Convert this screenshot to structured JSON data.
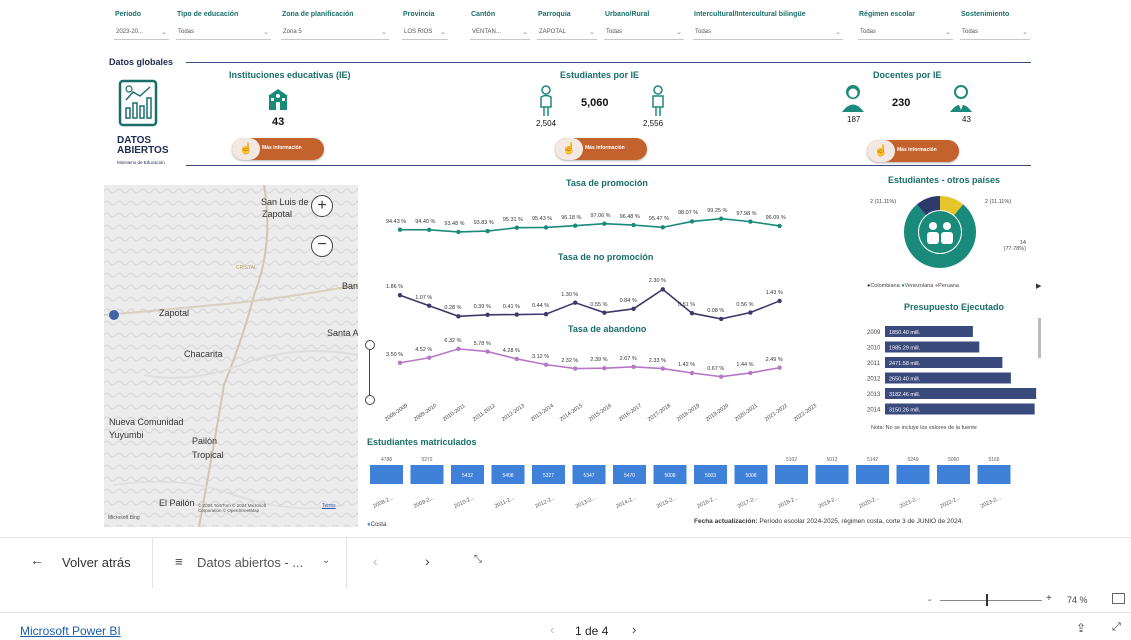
{
  "filters": [
    {
      "label": "Período",
      "value": "2023-20..."
    },
    {
      "label": "Tipo de educación",
      "value": "Todas"
    },
    {
      "label": "Zona de planificación",
      "value": "Zona 5"
    },
    {
      "label": "Provincia",
      "value": "LOS RIOS"
    },
    {
      "label": "Cantón",
      "value": "VENTAN..."
    },
    {
      "label": "Parroquia",
      "value": "ZAPOTAL"
    },
    {
      "label": "Urbano/Rural",
      "value": "Todas"
    },
    {
      "label": "Intercultural/Intercultural bilingüe",
      "value": "Todas"
    },
    {
      "label": "Régimen escolar",
      "value": "Todas"
    },
    {
      "label": "Sostenimiento",
      "value": "Todas"
    }
  ],
  "datos_globales": "Datos globales",
  "logo": {
    "line1": "DATOS",
    "line2": "ABIERTOS",
    "line3": "Ministerio de Educación"
  },
  "kpis": {
    "ie": {
      "title": "Instituciones educativas (IE)",
      "value": "43"
    },
    "estudiantes": {
      "title": "Estudiantes  por IE",
      "total": "5,060",
      "female": "2,504",
      "male": "2,556"
    },
    "docentes": {
      "title": "Docentes por IE",
      "total": "230",
      "female": "187",
      "male": "43"
    },
    "more_info": "Más información"
  },
  "map": {
    "places": [
      "San Luis de",
      "Zapotal",
      "Zapotal",
      "Chacarita",
      "Nueva Comunidad",
      "Yuyumbi",
      "Pailón",
      "Tropical",
      "El Pailón",
      "Ban",
      "Santa A",
      "CRISTAL"
    ],
    "copyright": "© 2024 TomTom  © 2024 Microsoft Corporation  © OpenStreetMap",
    "terms": "Terms",
    "brand": "Microsoft Bing",
    "legend": "Costa"
  },
  "periods": [
    "2008-2009",
    "2009-2010",
    "2010-2011",
    "2011-2012",
    "2012-2013",
    "2013-2014",
    "2014-2015",
    "2015-2016",
    "2016-2017",
    "2017-2018",
    "2018-2019",
    "2019-2020",
    "2020-2021",
    "2021-2022",
    "2022-2023"
  ],
  "chart_data": [
    {
      "type": "line",
      "title": "Tasa de promoción",
      "x": [
        "2009-2010",
        "2010-2011",
        "2011-2012",
        "2012-2013",
        "2013-2014",
        "2014-2015",
        "2015-2016",
        "2016-2017",
        "2017-2018",
        "2018-2019",
        "2019-2020",
        "2020-2021",
        "2021-2022",
        "2022-2023"
      ],
      "values": [
        94.43,
        94.4,
        93.48,
        93.83,
        95.31,
        95.43,
        96.18,
        97.06,
        96.48,
        95.47,
        98.07,
        99.25,
        97.98,
        96.09
      ],
      "labels": [
        "94.43 %",
        "94.40 %",
        "93.48 %",
        "93.83 %",
        "95.31 %",
        "95.43 %",
        "96.18 %",
        "97.06 %",
        "96.48 %",
        "95.47 %",
        "98.07 %",
        "99.25 %",
        "97.98 %",
        "96.09 %"
      ],
      "color": "#1a8a7a"
    },
    {
      "type": "line",
      "title": "Tasa de no promoción",
      "x": [
        "2009-2010",
        "2010-2011",
        "2011-2012",
        "2012-2013",
        "2013-2014",
        "2014-2015",
        "2015-2016",
        "2016-2017",
        "2017-2018",
        "2018-2019",
        "2019-2020",
        "2020-2021",
        "2021-2022",
        "2022-2023"
      ],
      "values": [
        1.86,
        1.07,
        0.28,
        0.39,
        0.41,
        0.44,
        1.3,
        0.55,
        0.84,
        2.3,
        0.51,
        0.08,
        0.56,
        1.43
      ],
      "labels": [
        "1.86 %",
        "1.07 %",
        "0.28 %",
        "0.39 %",
        "0.41 %",
        "0.44 %",
        "1.30 %",
        "0.55 %",
        "0.84 %",
        "2.30 %",
        "0.51 %",
        "0.08 %",
        "0.56 %",
        "1.43 %"
      ],
      "color": "#3d3a6b"
    },
    {
      "type": "line",
      "title": "Tasa de abandono",
      "x": [
        "2009-2010",
        "2010-2011",
        "2011-2012",
        "2012-2013",
        "2013-2014",
        "2014-2015",
        "2015-2016",
        "2016-2017",
        "2017-2018",
        "2018-2019",
        "2019-2020",
        "2020-2021",
        "2021-2022",
        "2022-2023"
      ],
      "values": [
        3.5,
        4.52,
        6.32,
        5.78,
        4.28,
        3.12,
        2.32,
        2.39,
        2.67,
        2.33,
        1.42,
        0.67,
        1.44,
        2.49
      ],
      "labels": [
        "3.50 %",
        "4.52 %",
        "6.32 %",
        "5.78 %",
        "4.28 %",
        "3.12 %",
        "2.32 %",
        "2.39 %",
        "2.67 %",
        "2.33 %",
        "1.42 %",
        "0.67 %",
        "1.44 %",
        "2.49 %"
      ],
      "color": "#b678c4"
    },
    {
      "type": "bar",
      "title": "Estudiantes matriculados",
      "categories": [
        "2008-2...",
        "2009-2...",
        "2010-2...",
        "2011-2...",
        "2012-2...",
        "2013-2...",
        "2014-2...",
        "2015-2...",
        "2016-2...",
        "2017-2...",
        "2018-2...",
        "2019-2...",
        "2020-2...",
        "2021-2...",
        "2022-2...",
        "2023-2..."
      ],
      "labels": [
        "4788",
        "5272",
        "5432",
        "5408",
        "5327",
        "5347",
        "5470",
        "5008",
        "5003",
        "5008",
        "5102",
        "5012",
        "5142",
        "5249",
        "5060",
        "5166"
      ],
      "series": [
        {
          "name": "Costa"
        }
      ],
      "color": "#3f80d8"
    },
    {
      "type": "pie",
      "title": "Estudiantes - otros países",
      "slices": [
        {
          "name": "Colombiana",
          "value": 2,
          "label": "2 (11.11%)",
          "color": "#2c3a6b"
        },
        {
          "name": "Venezolana",
          "value": 14,
          "label": "14 (77.78%)",
          "color": "#1a8a7a"
        },
        {
          "name": "Peruana",
          "value": 2,
          "label": "2 (11.11%)",
          "color": "#e5c52a"
        }
      ]
    },
    {
      "type": "bar",
      "title": "Presupuesto Ejecutado",
      "categories": [
        "2009",
        "2010",
        "2011",
        "2012",
        "2013",
        "2014"
      ],
      "values": [
        1850.4,
        1985.29,
        2471.58,
        2650.4,
        3182.46,
        3150.26
      ],
      "labels": [
        "1850.40 mill.",
        "1985.29 mill.",
        "2471.58 mill.",
        "2650.40 mill.",
        "3182.46 mill.",
        "3150.26 mill."
      ],
      "color": "#3a4a7c"
    }
  ],
  "pie_legend": [
    "Colombiana",
    "Venezolana",
    "Peruana"
  ],
  "budget_note": "Nota: No se incluye los valores de la fuente",
  "update_note": {
    "label": "Fecha actualización:",
    "text": "Período escolar 2024-2025, régimen costa, corte 3 de JUNIO de 2024."
  },
  "nav": {
    "back": "Volver atrás",
    "page_menu": "Datos abiertos - ...",
    "zoom": "74 %"
  },
  "footer": {
    "brand": "Microsoft Power BI",
    "pages": "1 de 4"
  }
}
